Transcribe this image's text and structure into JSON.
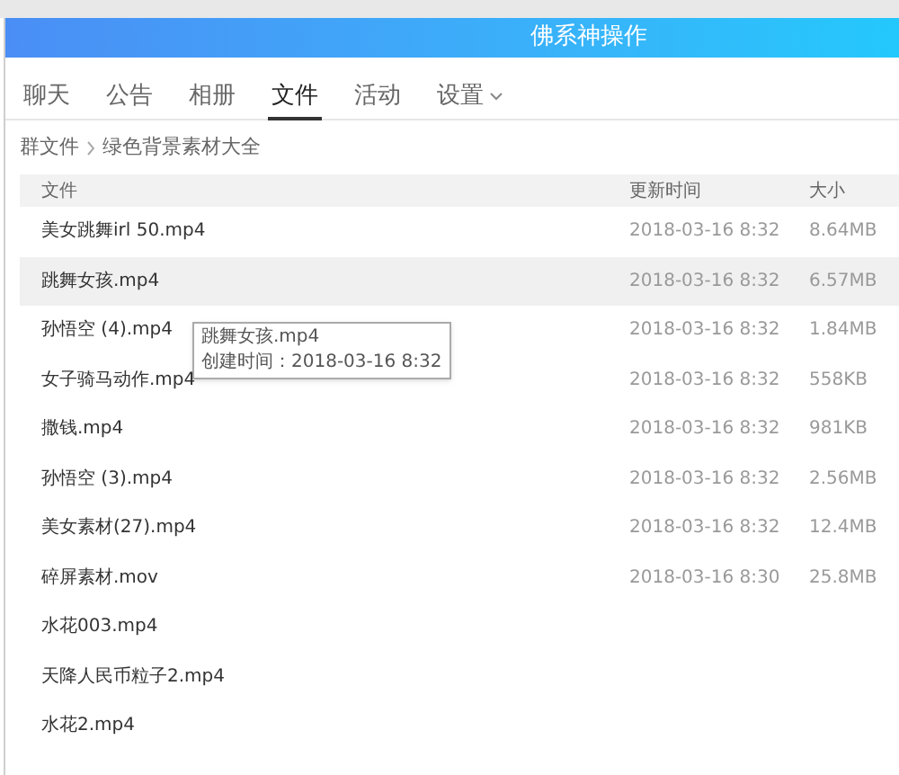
{
  "window": {
    "title": "佛系神操作"
  },
  "tabs": [
    {
      "label": "聊天",
      "selected": false
    },
    {
      "label": "公告",
      "selected": false
    },
    {
      "label": "相册",
      "selected": false
    },
    {
      "label": "文件",
      "selected": true
    },
    {
      "label": "活动",
      "selected": false
    },
    {
      "label": "设置",
      "selected": false,
      "dropdown": true
    }
  ],
  "breadcrumb": [
    "群文件",
    "绿色背景素材大全"
  ],
  "table": {
    "columns": [
      "文件",
      "更新时间",
      "大小"
    ],
    "rows": [
      {
        "name": "美女跳舞irl 50.mp4",
        "time": "2018-03-16 8:32",
        "size": "8.64MB",
        "selected": false
      },
      {
        "name": "跳舞女孩.mp4",
        "time": "2018-03-16 8:32",
        "size": "6.57MB",
        "selected": true
      },
      {
        "name": "孙悟空 (4).mp4",
        "time": "2018-03-16 8:32",
        "size": "1.84MB",
        "selected": false
      },
      {
        "name": "女子骑马动作.mp4",
        "time": "2018-03-16 8:32",
        "size": "558KB",
        "selected": false
      },
      {
        "name": "撒钱.mp4",
        "time": "2018-03-16 8:32",
        "size": "981KB",
        "selected": false
      },
      {
        "name": "孙悟空 (3).mp4",
        "time": "2018-03-16 8:32",
        "size": "2.56MB",
        "selected": false
      },
      {
        "name": "美女素材(27).mp4",
        "time": "2018-03-16 8:32",
        "size": "12.4MB",
        "selected": false
      },
      {
        "name": "碎屏素材.mov",
        "time": "2018-03-16 8:30",
        "size": "25.8MB",
        "selected": false
      },
      {
        "name": "水花003.mp4",
        "selected": false
      },
      {
        "name": "天降人民币粒子2.mp4",
        "selected": false
      },
      {
        "name": "水花2.mp4",
        "selected": false
      }
    ]
  },
  "tooltip": {
    "title": "跳舞女孩.mp4",
    "detail": "创建时间：2018-03-16 8:32"
  }
}
